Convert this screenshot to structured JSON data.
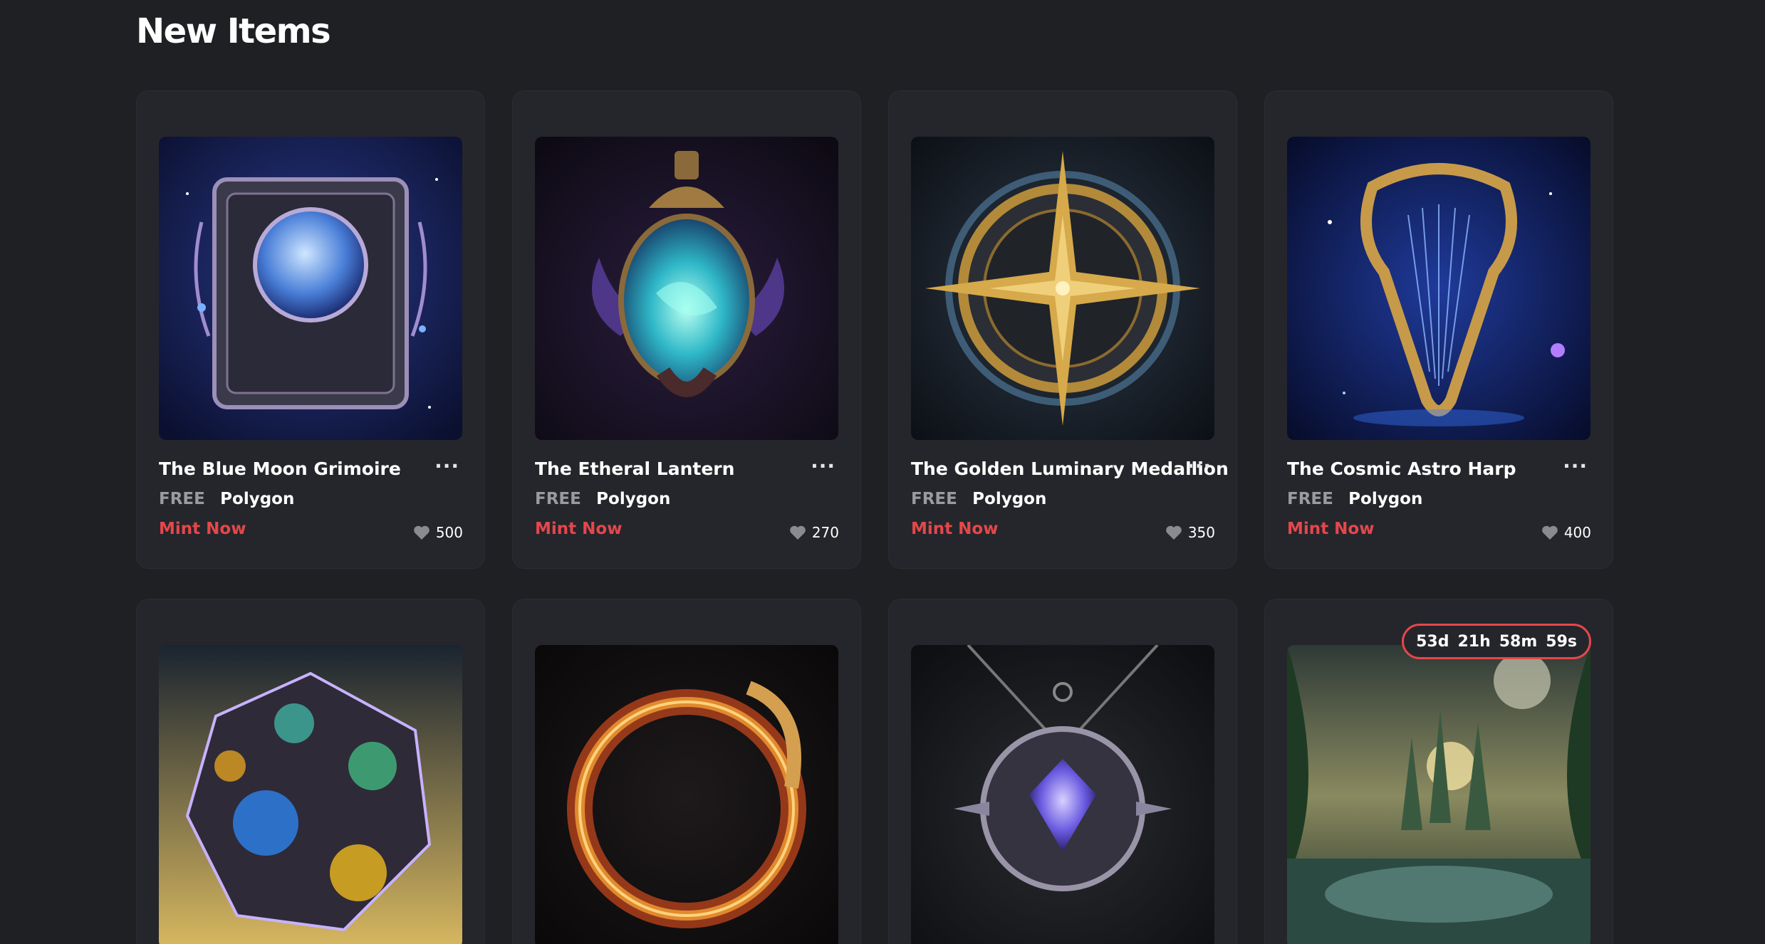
{
  "section": {
    "title": "New Items"
  },
  "items": [
    {
      "name": "The Blue Moon Grimoire",
      "price": "FREE",
      "chain": "Polygon",
      "action": "Mint Now",
      "likes": "500"
    },
    {
      "name": "The Etheral Lantern",
      "price": "FREE",
      "chain": "Polygon",
      "action": "Mint Now",
      "likes": "270"
    },
    {
      "name": "The Golden Luminary Medallion",
      "price": "FREE",
      "chain": "Polygon",
      "action": "Mint Now",
      "likes": "350"
    },
    {
      "name": "The Cosmic Astro Harp",
      "price": "FREE",
      "chain": "Polygon",
      "action": "Mint Now",
      "likes": "400"
    }
  ],
  "timer": {
    "days": "53d",
    "hours": "21h",
    "minutes": "58m",
    "seconds": "59s"
  },
  "colors": {
    "accent": "#e5474b",
    "background": "#1f2024",
    "card": "#25262b"
  },
  "icons": [
    "heart-icon",
    "more-options-icon"
  ]
}
